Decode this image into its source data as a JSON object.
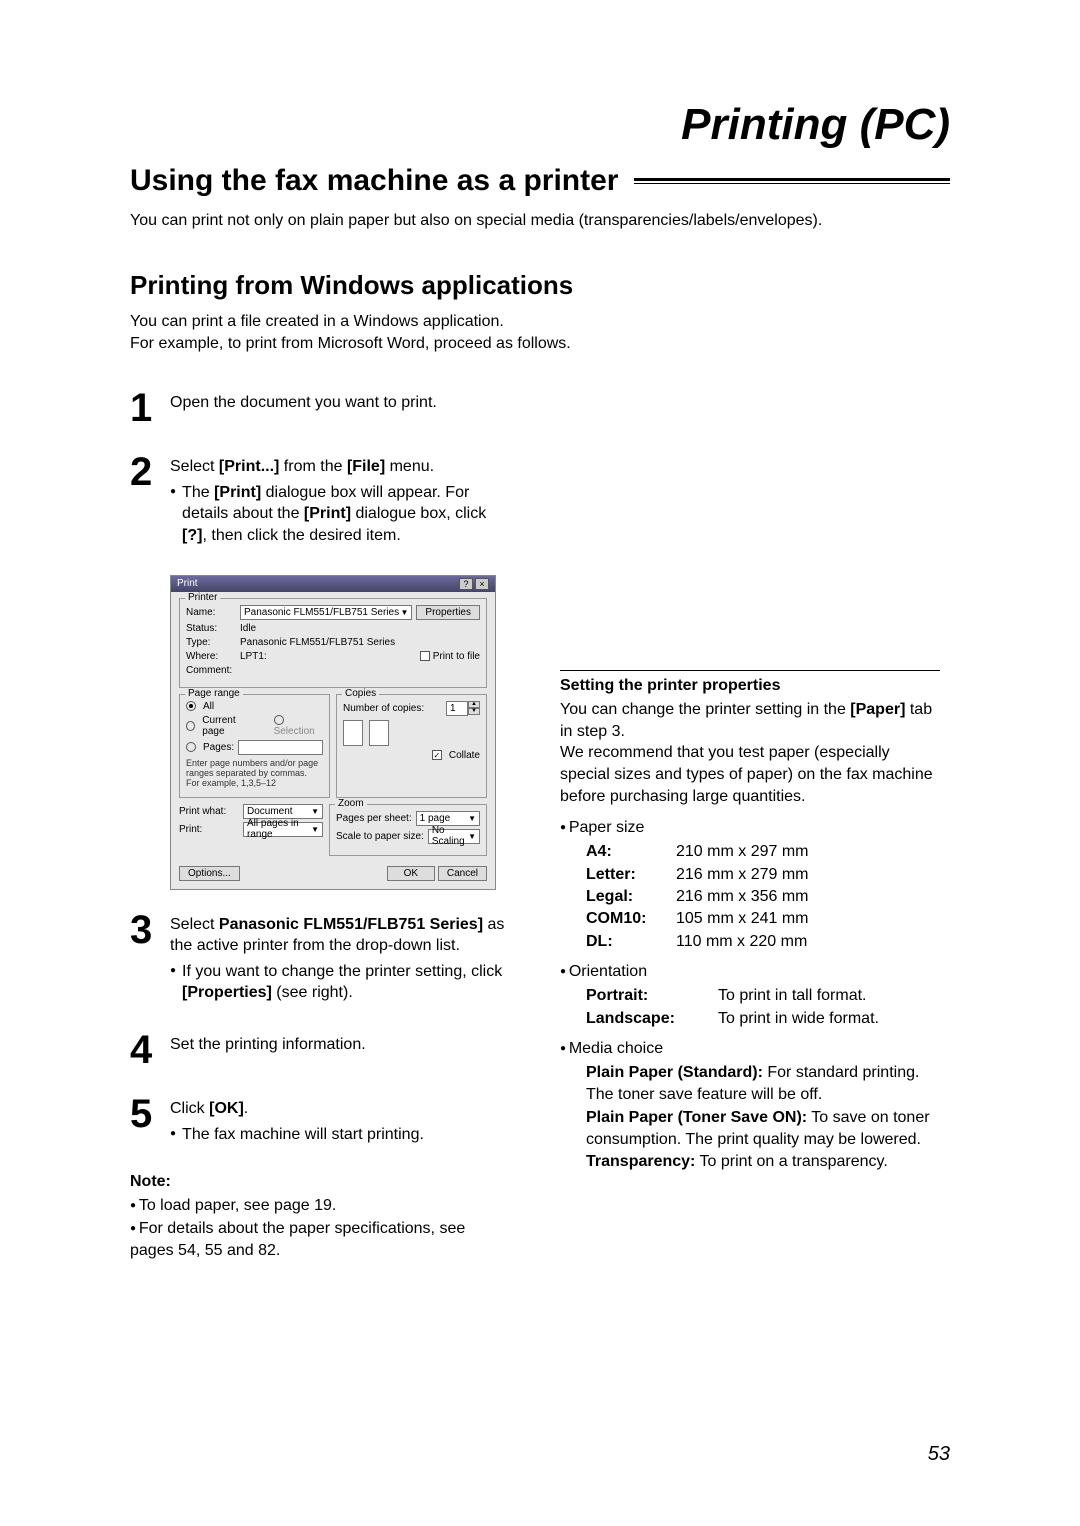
{
  "header": "Printing (PC)",
  "mainTitle": "Using the fax machine as a printer",
  "intro": "You can print not only on plain paper but also on special media (transparencies/labels/envelopes).",
  "subTitle": "Printing from Windows applications",
  "subDesc1": "You can print a file created in a Windows application.",
  "subDesc2": "For example, to print from Microsoft Word, proceed as follows.",
  "steps": {
    "s1": {
      "num": "1",
      "text": "Open the document you want to print."
    },
    "s2": {
      "num": "2",
      "text_a": "Select ",
      "text_b": "[Print...]",
      "text_c": " from the ",
      "text_d": "[File]",
      "text_e": " menu.",
      "sub_a": "The ",
      "sub_b": "[Print]",
      "sub_c": " dialogue box will appear. For details about the ",
      "sub_d": "[Print]",
      "sub_e": " dialogue box, click ",
      "sub_f": "[?]",
      "sub_g": ", then click the desired item."
    },
    "s3": {
      "num": "3",
      "text_a": "Select ",
      "text_b": "Panasonic FLM551/FLB751 Series]",
      "text_c": " as the active printer from the drop-down list.",
      "sub_a": "If you want to change the printer setting, click ",
      "sub_b": "[Properties]",
      "sub_c": " (see right)."
    },
    "s4": {
      "num": "4",
      "text": "Set the printing information."
    },
    "s5": {
      "num": "5",
      "text_a": "Click ",
      "text_b": "[OK]",
      "text_c": ".",
      "sub": "The fax machine will start printing."
    }
  },
  "note": {
    "head": "Note:",
    "b1": "To load paper, see page 19.",
    "b2": "For details about the paper specifications, see pages 54, 55 and 82."
  },
  "right": {
    "head": "Setting the printer properties",
    "p1a": "You can change the printer setting in the ",
    "p1b": "[Paper]",
    "p1c": " tab in step 3.",
    "p2": "We recommend that you test paper (especially special sizes and types of paper) on the fax machine before purchasing large quantities.",
    "paperSizeLabel": "Paper size",
    "sizes": {
      "A4": {
        "k": "A4:",
        "v": "210 mm x 297 mm"
      },
      "Letter": {
        "k": "Letter:",
        "v": "216 mm x 279 mm"
      },
      "Legal": {
        "k": "Legal:",
        "v": "216 mm x 356 mm"
      },
      "COM10": {
        "k": "COM10:",
        "v": "105 mm x 241 mm"
      },
      "DL": {
        "k": "DL:",
        "v": "110 mm x 220 mm"
      }
    },
    "orientLabel": "Orientation",
    "orient": {
      "portrait": {
        "k": "Portrait:",
        "v": "To print in tall format."
      },
      "landscape": {
        "k": "Landscape:",
        "v": "To print in wide format."
      }
    },
    "mediaLabel": "Media choice",
    "media": {
      "m1a": "Plain Paper (Standard):",
      "m1b": " For standard printing. The toner save feature will be off.",
      "m2a": "Plain Paper (Toner Save ON):",
      "m2b": " To save on toner consumption. The print quality may be lowered.",
      "m3a": "Transparency:",
      "m3b": " To print on a transparency."
    }
  },
  "dialog": {
    "title": "Print",
    "printerLegend": "Printer",
    "nameLabel": "Name:",
    "nameValue": "Panasonic FLM551/FLB751 Series",
    "propertiesBtn": "Properties",
    "statusLabel": "Status:",
    "statusValue": "Idle",
    "typeLabel": "Type:",
    "typeValue": "Panasonic FLM551/FLB751 Series",
    "whereLabel": "Where:",
    "whereValue": "LPT1:",
    "commentLabel": "Comment:",
    "printToFile": "Print to file",
    "rangeLegend": "Page range",
    "all": "All",
    "currentPage": "Current page",
    "selection": "Selection",
    "pages": "Pages:",
    "rangeHint": "Enter page numbers and/or page ranges separated by commas. For example, 1,3,5–12",
    "copiesLegend": "Copies",
    "numCopies": "Number of copies:",
    "numCopiesValue": "1",
    "collate": "Collate",
    "zoomLegend": "Zoom",
    "printWhat": "Print what:",
    "printWhatValue": "Document",
    "pagesPerSheet": "Pages per sheet:",
    "pagesPerSheetValue": "1 page",
    "printLabel": "Print:",
    "printValue": "All pages in range",
    "scaleLabel": "Scale to paper size:",
    "scaleValue": "No Scaling",
    "optionsBtn": "Options...",
    "okBtn": "OK",
    "cancelBtn": "Cancel"
  },
  "pageNum": "53"
}
